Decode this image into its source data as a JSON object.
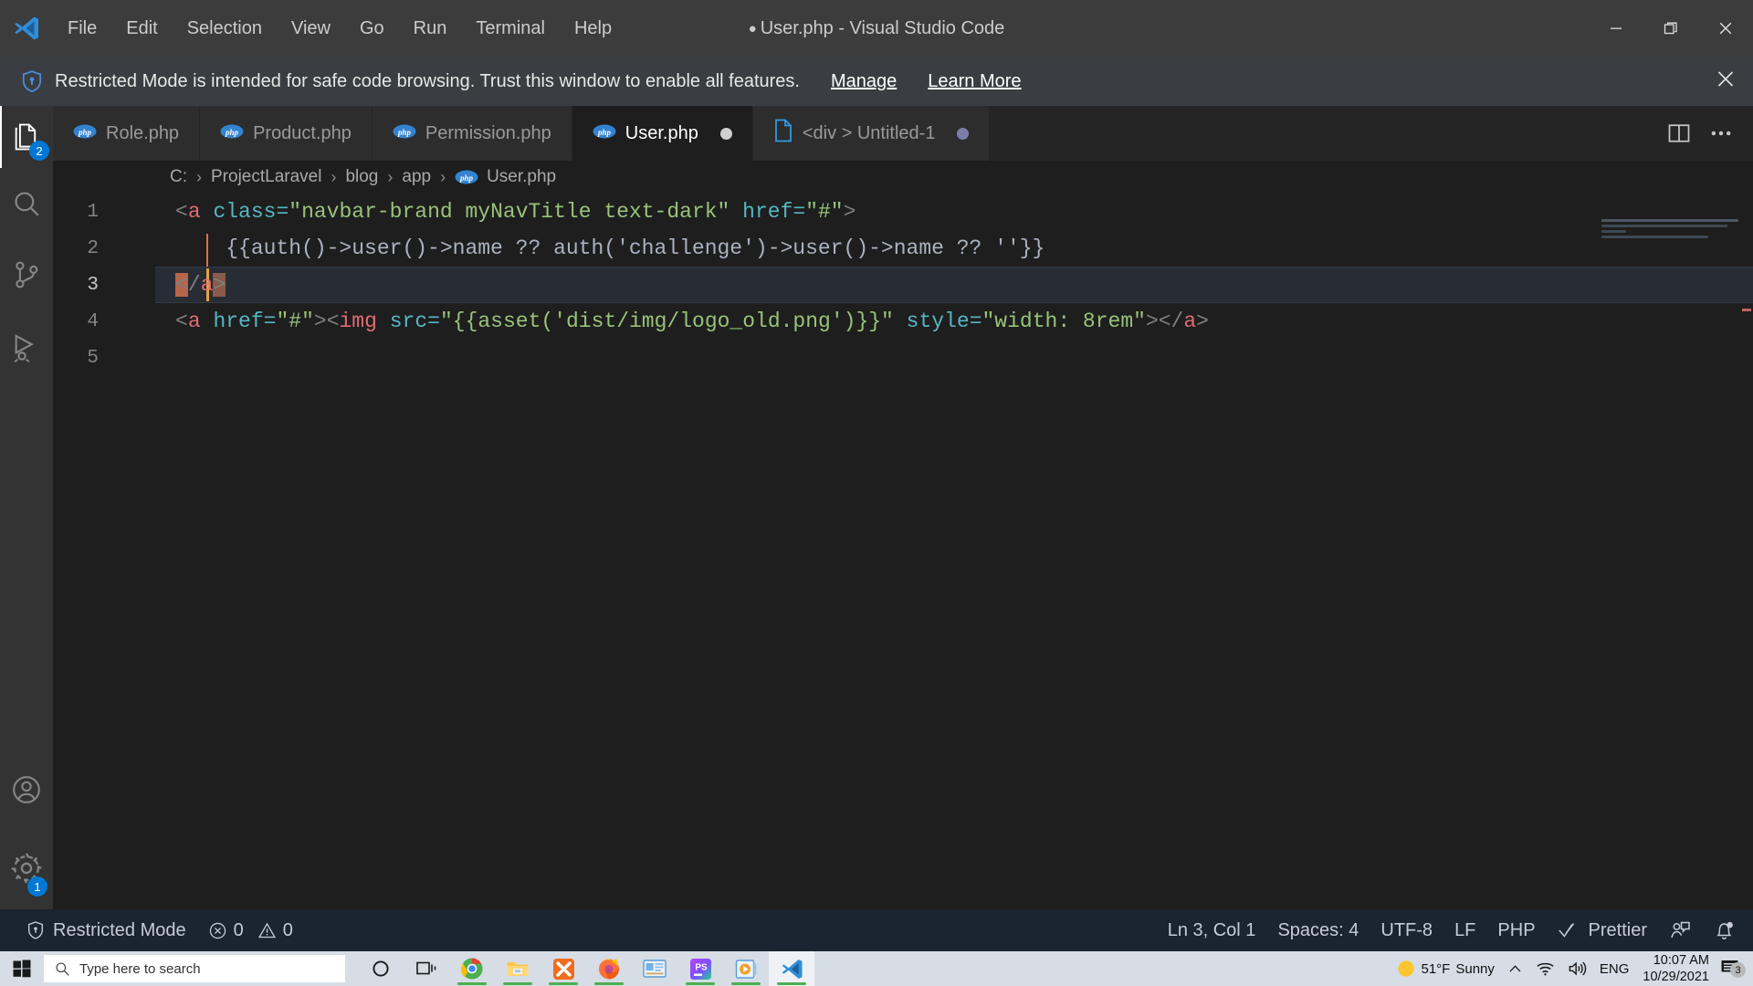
{
  "titlebar": {
    "menus": [
      "File",
      "Edit",
      "Selection",
      "View",
      "Go",
      "Run",
      "Terminal",
      "Help"
    ],
    "window_title": "User.php - Visual Studio Code",
    "dirty_indicator": "●",
    "minimize_label": "Minimize",
    "restore_label": "Restore",
    "close_label": "Close"
  },
  "banner": {
    "icon": "shield-icon",
    "message": "Restricted Mode is intended for safe code browsing. Trust this window to enable all features.",
    "manage_link": "Manage",
    "learn_more_link": "Learn More",
    "close_label": "Close banner"
  },
  "activitybar": {
    "items": [
      {
        "name": "explorer",
        "icon": "files-icon",
        "badge": "2",
        "active": true
      },
      {
        "name": "search",
        "icon": "search-icon",
        "badge": ""
      },
      {
        "name": "source-control",
        "icon": "source-control-icon",
        "badge": ""
      },
      {
        "name": "run-and-debug",
        "icon": "run-debug-icon",
        "badge": ""
      }
    ],
    "bottom_items": [
      {
        "name": "accounts",
        "icon": "account-icon",
        "badge": ""
      },
      {
        "name": "settings",
        "icon": "gear-icon",
        "badge": "1"
      }
    ]
  },
  "tabs": [
    {
      "label": "Role.php",
      "icon": "php-icon",
      "active": false,
      "dirty": false
    },
    {
      "label": "Product.php",
      "icon": "php-icon",
      "active": false,
      "dirty": false
    },
    {
      "label": "Permission.php",
      "icon": "php-icon",
      "active": false,
      "dirty": false
    },
    {
      "label": "User.php",
      "icon": "php-icon",
      "active": true,
      "dirty": true
    },
    {
      "label": "<div > Untitled-1",
      "icon": "file-icon",
      "active": false,
      "dirty": true,
      "untitled": true
    }
  ],
  "tab_actions": {
    "split_editor": "split-editor-icon",
    "more_actions": "more-actions-icon"
  },
  "breadcrumb": {
    "parts": [
      "C:",
      "ProjectLaravel",
      "blog",
      "app",
      "User.php"
    ],
    "separator": "›",
    "file_icon": "php-icon"
  },
  "editor": {
    "lines": [
      {
        "number": "1",
        "text": "<a class=\"navbar-brand myNavTitle text-dark\" href=\"#\">"
      },
      {
        "number": "2",
        "text": "    {{auth()->user()->name ?? auth('challenge')->user()->name ?? ''}}"
      },
      {
        "number": "3",
        "text": "</a>"
      },
      {
        "number": "4",
        "text": "<a href=\"#\"><img src=\"{{asset('dist/img/logo_old.png')}}\" style=\"width: 8rem\"></a>"
      },
      {
        "number": "5",
        "text": ""
      }
    ],
    "active_line": "3",
    "colors": {
      "background": "#1e1e1e",
      "tag": "#e06c75",
      "attribute": "#56b6c2",
      "string": "#98c379",
      "punctuation": "#808080",
      "plain": "#abb2bf",
      "cursor": "#e8a33d",
      "bracket_highlight": "#8a5a4a"
    }
  },
  "statusbar": {
    "restricted_mode": "Restricted Mode",
    "restricted_icon": "shield-lock-icon",
    "errors_icon": "error-circle-icon",
    "errors": "0",
    "warnings_icon": "warning-triangle-icon",
    "warnings": "0",
    "cursor_position": "Ln 3, Col 1",
    "indentation": "Spaces: 4",
    "encoding": "UTF-8",
    "eol": "LF",
    "language": "PHP",
    "formatter": "Prettier",
    "formatter_icon": "checkmarks-icon",
    "remote_icon": "live-share-icon",
    "bell_icon": "bell-dot-icon"
  },
  "taskbar": {
    "start_label": "Start",
    "search_placeholder": "Type here to search",
    "search_icon": "search-icon",
    "cortana_icon": "cortana-circle-icon",
    "taskview_icon": "task-view-icon",
    "apps": [
      {
        "name": "google-chrome",
        "running": true,
        "active": false
      },
      {
        "name": "file-explorer",
        "running": true,
        "active": false
      },
      {
        "name": "xampp",
        "running": true,
        "active": false
      },
      {
        "name": "firefox",
        "running": true,
        "active": false
      },
      {
        "name": "presentation",
        "running": false,
        "active": false
      },
      {
        "name": "phpstorm",
        "running": true,
        "active": false
      },
      {
        "name": "media-player",
        "running": true,
        "active": false
      },
      {
        "name": "visual-studio-code",
        "running": true,
        "active": true
      }
    ],
    "weather_temp": "51°F",
    "weather_desc": "Sunny",
    "weather_icon": "sun-icon",
    "chevron_icon": "chevron-up-icon",
    "network_icon": "wifi-icon",
    "volume_icon": "speaker-icon",
    "language": "ENG",
    "time": "10:07 AM",
    "date": "10/29/2021",
    "notification_icon": "notification-icon",
    "notification_count": "3"
  }
}
